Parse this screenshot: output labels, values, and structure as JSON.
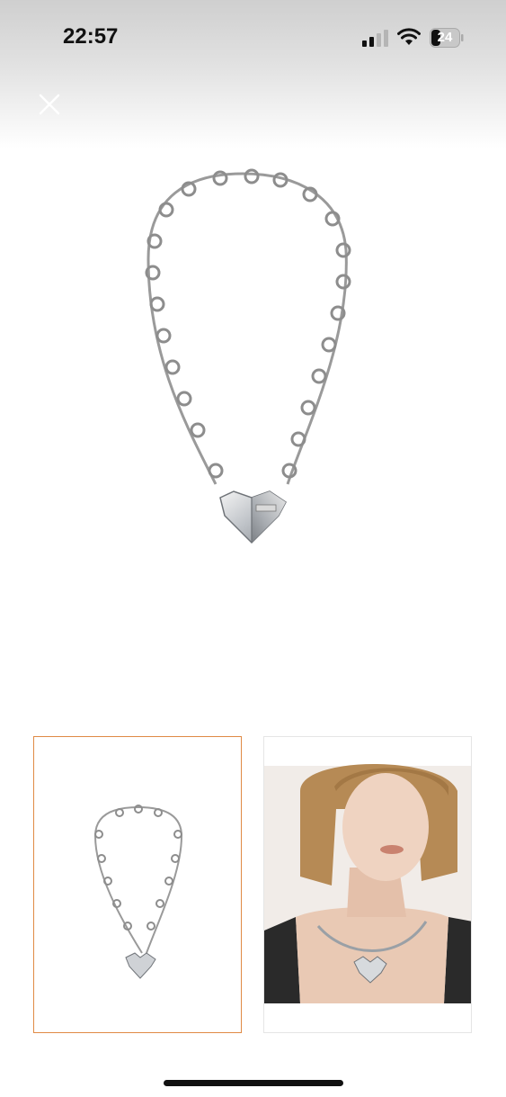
{
  "status_bar": {
    "time": "22:57",
    "battery": "24"
  },
  "viewer": {
    "close_icon": "close-icon",
    "main_image": "necklace-product-photo",
    "thumbnails": [
      {
        "image": "necklace-product-photo",
        "selected": true
      },
      {
        "image": "model-wearing-necklace-photo",
        "selected": false
      }
    ],
    "accent_color": "#e08a45"
  }
}
